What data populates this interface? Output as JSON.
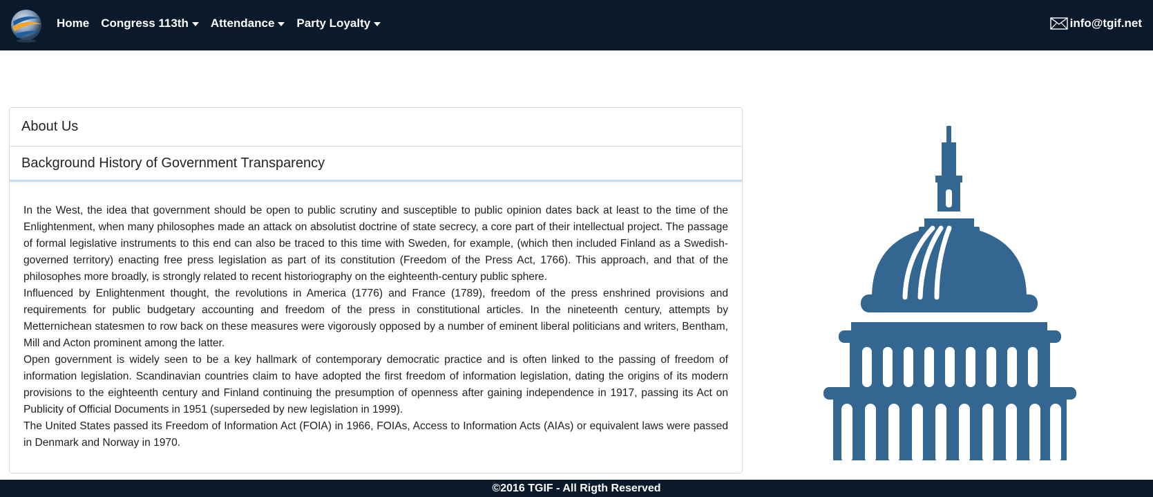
{
  "navbar": {
    "logo_icon": "globe-logo-icon",
    "items": [
      {
        "label": "Home",
        "dropdown": false
      },
      {
        "label": "Congress 113th",
        "dropdown": true
      },
      {
        "label": "Attendance",
        "dropdown": true
      },
      {
        "label": "Party Loyalty",
        "dropdown": true
      }
    ],
    "email": "info@tgif.net",
    "email_icon": "envelope-icon"
  },
  "accordion": {
    "sections": [
      {
        "title": "About Us"
      },
      {
        "title": "Background History of Government Transparency"
      }
    ],
    "paragraphs": [
      "In the West, the idea that government should be open to public scrutiny and susceptible to public opinion dates back at least to the time of the Enlightenment, when many philosophes made an attack on absolutist doctrine of state secrecy, a core part of their intellectual project. The passage of formal legislative instruments to this end can also be traced to this time with Sweden, for example, (which then included Finland as a Swedish-governed territory) enacting free press legislation as part of its constitution (Freedom of the Press Act, 1766). This approach, and that of the philosophes more broadly, is strongly related to recent historiography on the eighteenth-century public sphere.",
      "Influenced by Enlightenment thought, the revolutions in America (1776) and France (1789), freedom of the press enshrined provisions and requirements for public budgetary accounting and freedom of the press in constitutional articles. In the nineteenth century, attempts by Metternichean statesmen to row back on these measures were vigorously opposed by a number of eminent liberal politicians and writers, Bentham, Mill and Acton prominent among the latter.",
      "Open government is widely seen to be a key hallmark of contemporary democratic practice and is often linked to the passing of freedom of information legislation. Scandinavian countries claim to have adopted the first freedom of information legislation, dating the origins of its modern provisions to the eighteenth century and Finland continuing the presumption of openness after gaining independence in 1917, passing its Act on Publicity of Official Documents in 1951 (superseded by new legislation in 1999).",
      "The United States passed its Freedom of Information Act (FOIA) in 1966, FOIAs, Access to Information Acts (AIAs) or equivalent laws were passed in Denmark and Norway in 1970."
    ]
  },
  "illustration": {
    "icon": "capitol-building-icon",
    "color": "#336791"
  },
  "footer": {
    "text": "©2016 TGIF - All Rigth Reserved"
  },
  "colors": {
    "navbar_bg": "#0b1a2b",
    "accent": "#336791"
  }
}
